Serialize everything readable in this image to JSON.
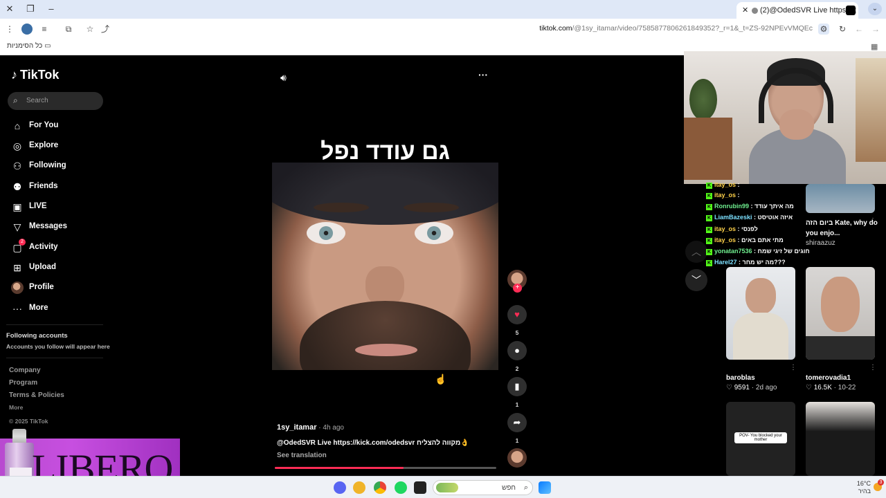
{
  "browser": {
    "tab_title": "(2)@OdedSVR Live https://k",
    "url_domain": "tiktok.com",
    "url_path": "/@1sy_itamar/video/7585877806261849352?_r=1&_t=ZS-92NPEvVMQEc",
    "bookmarks_label": "כל הסימניות"
  },
  "sidebar": {
    "logo": "TikTok",
    "search_placeholder": "Search",
    "nav": [
      {
        "label": "For You",
        "icon": "home-icon"
      },
      {
        "label": "Explore",
        "icon": "compass-icon"
      },
      {
        "label": "Following",
        "icon": "following-icon"
      },
      {
        "label": "Friends",
        "icon": "friends-icon"
      },
      {
        "label": "LIVE",
        "icon": "live-icon"
      },
      {
        "label": "Messages",
        "icon": "send-icon"
      },
      {
        "label": "Activity",
        "icon": "activity-icon",
        "badge": "2"
      },
      {
        "label": "Upload",
        "icon": "upload-icon"
      },
      {
        "label": "Profile",
        "icon": "avatar"
      },
      {
        "label": "More",
        "icon": "more-icon"
      }
    ],
    "following_title": "Following accounts",
    "following_sub": "Accounts you follow will appear here",
    "footer": [
      "Company",
      "Program",
      "Terms & Policies"
    ],
    "footer_more": "More",
    "copyright": "© 2025 TikTok",
    "ad_text": "LIBERO"
  },
  "video": {
    "caption": "גם עודד נפל",
    "author": "1sy_itamar",
    "time": " · 4h ago",
    "description": "@OdedSVR Live  https://kick.com/odedsvr מקווה להצליח👌",
    "see_translation": "See translation",
    "progress": 0.58,
    "likes": "5",
    "comments": "2",
    "saves": "1",
    "shares": "1"
  },
  "stream_chat": [
    {
      "user": "itay_os",
      "msg": ":",
      "color": "u"
    },
    {
      "user": "itay_os",
      "msg": ":",
      "color": "u"
    },
    {
      "user": "Ronrubin99",
      "msg": ": מה איתך עודד",
      "color": "u3"
    },
    {
      "user": "LiamBazeski",
      "msg": ": איזה אוטיסט",
      "color": "u2"
    },
    {
      "user": "itay_os",
      "msg": ": לפנסי",
      "color": "u"
    },
    {
      "user": "itay_os",
      "msg": ": מתי אתם באים",
      "color": "u"
    },
    {
      "user": "yonatan7536",
      "msg": ": וזה מחוגים של זיגי שמח",
      "color": "u3"
    },
    {
      "user": "Harel27",
      "msg": ": מה יש מחר???",
      "color": "u2"
    }
  ],
  "recommended": {
    "top_right": {
      "title": "ביום הזה Kate, why do you enjo...",
      "user": "shiraazuz"
    },
    "cards": [
      {
        "user": "baroblas",
        "likes": "9591",
        "age": "2d ago"
      },
      {
        "user": "tomerovadia1",
        "likes": "16.5K",
        "age": "10-22"
      }
    ],
    "bottom_text": "POV- You blocked your mother"
  },
  "taskbar": {
    "search_text": "חפש",
    "temp": "16°C",
    "weather": "בהיר",
    "notif": "3"
  }
}
